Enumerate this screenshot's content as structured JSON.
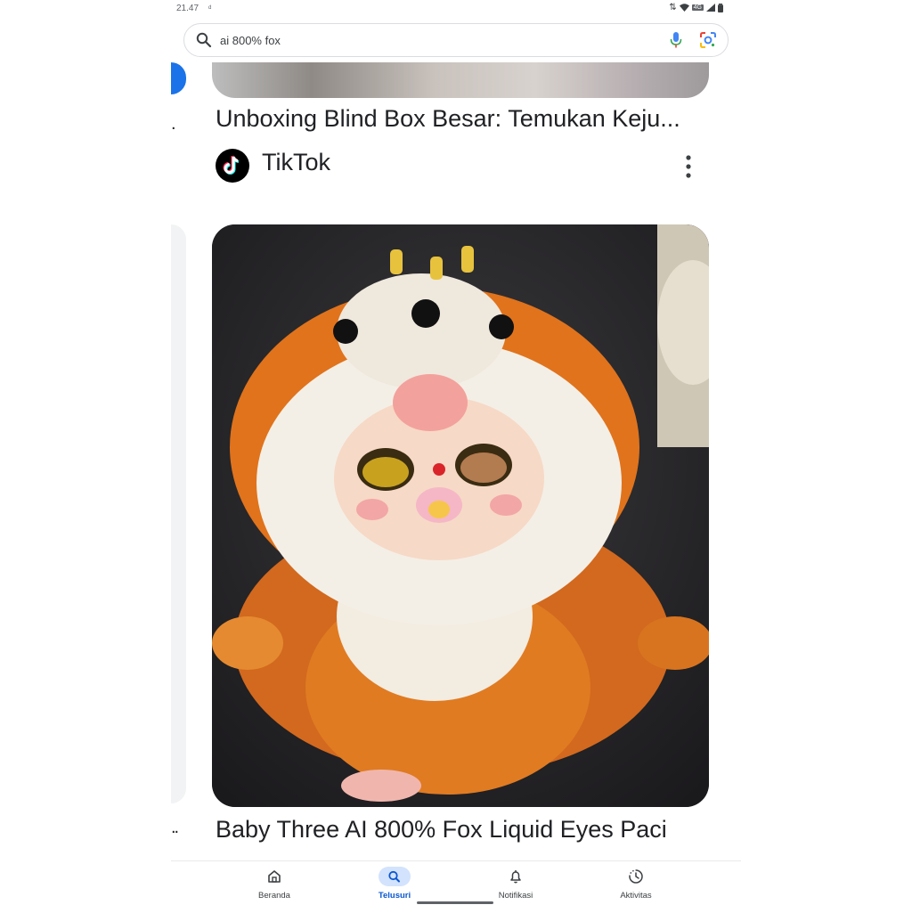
{
  "status_bar": {
    "time": "21.47",
    "notification_glyph": "ᵈ",
    "network_badge": "4G"
  },
  "search": {
    "query": "ai 800% fox"
  },
  "results": [
    {
      "title": "Unboxing Blind Box Besar: Temukan Keju...",
      "source": "TikTok",
      "source_icon": "tiktok-logo-icon"
    },
    {
      "title": "Baby Three AI 800% Fox Liquid Eyes Paci",
      "image_subject": "orange fox plush doll"
    }
  ],
  "left_column": {
    "top_ellipsis": ".",
    "bottom_ellipsis": ".."
  },
  "bottom_nav": {
    "items": [
      {
        "label": "Beranda",
        "icon": "home-icon"
      },
      {
        "label": "Telusuri",
        "icon": "search-icon",
        "active": true
      },
      {
        "label": "Notifikasi",
        "icon": "bell-icon"
      },
      {
        "label": "Aktivitas",
        "icon": "activity-icon"
      }
    ]
  },
  "colors": {
    "accent": "#0b57d0",
    "active_pill": "#d3e3fd",
    "google_blue": "#1a73e8"
  }
}
